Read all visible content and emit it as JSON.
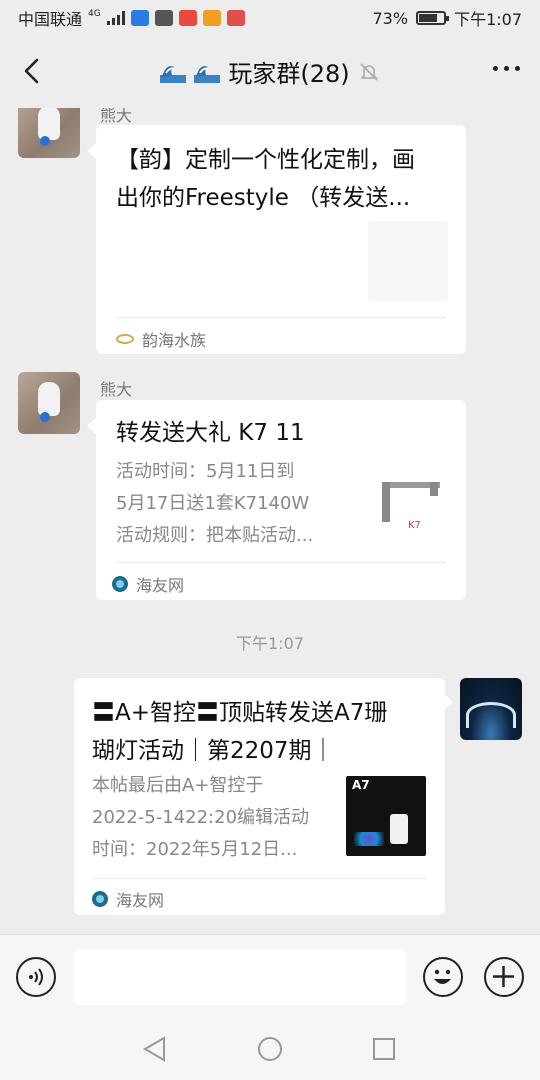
{
  "status": {
    "carrier": "中国联通",
    "network": "4G",
    "battery": "73%",
    "battery_level": 0.73,
    "time": "下午1:07"
  },
  "header": {
    "title": "玩家群(28)"
  },
  "messages": [
    {
      "sender": "熊大",
      "title": "【韵】定制一个性化定制，画出你的Freestyle （转发送...",
      "title_lines": [
        "【韵】定制一个性化定制，画",
        "出你的Freestyle （转发送..."
      ],
      "source": "韵海水族"
    },
    {
      "sender": "熊大",
      "title": "转发送大礼 K7 11",
      "desc_lines": [
        "活动时间：5月11日到",
        "5月17日送1套K7140W",
        "活动规则：把本贴活动..."
      ],
      "source": "海友网"
    }
  ],
  "timestamp": "下午1:07",
  "my_message": {
    "title_lines": [
      "〓A+智控〓顶贴转发送A7珊",
      "瑚灯活动｜第2207期｜"
    ],
    "desc_lines": [
      "本帖最后由A+智控于",
      "2022-5-1422:20编辑活动",
      "时间：2022年5月12日..."
    ],
    "thumb_label": "A7",
    "source": "海友网"
  },
  "colors": {
    "background": "#ededed",
    "bubble": "#ffffff",
    "muted_text": "#888888",
    "timestamp": "#999999"
  }
}
